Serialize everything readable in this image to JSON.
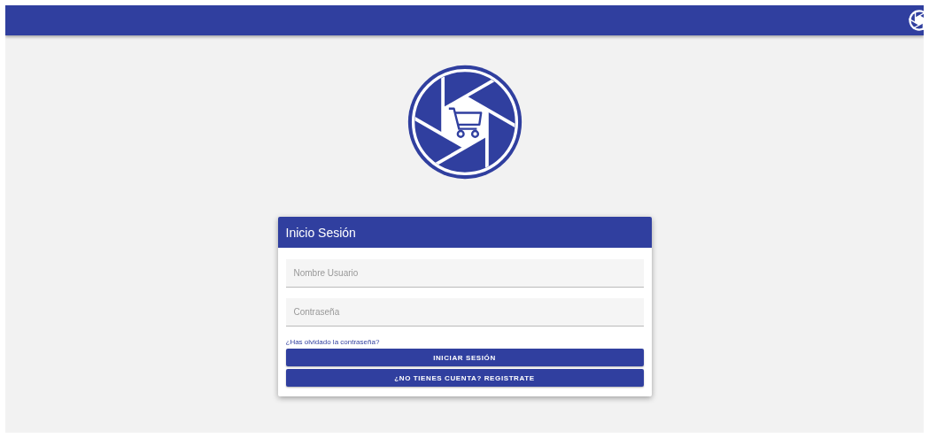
{
  "login": {
    "title": "Inicio Sesión",
    "fields": [
      {
        "placeholder": "Nombre Usuario"
      },
      {
        "placeholder": "Contraseña"
      }
    ],
    "forgot_link": "¿Has olvidado la contraseña?",
    "buttons": [
      "INICIAR SESIÓN",
      "¿NO TIENES CUENTA? REGISTRATE"
    ]
  }
}
